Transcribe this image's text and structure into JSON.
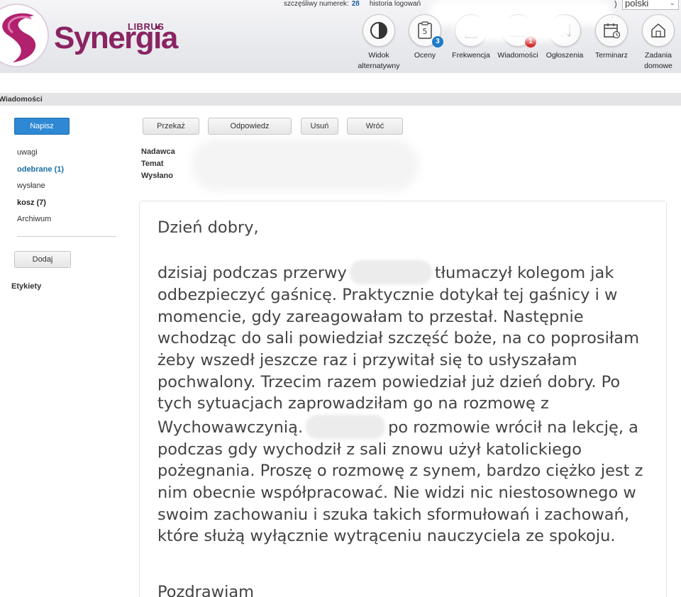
{
  "brand": {
    "product": "Synergia",
    "vendor": "LIBRUS"
  },
  "topbar": {
    "lucky_label": "szczęśliwy numerek:",
    "lucky_number": "28",
    "login_history": "historia logowań",
    "paren": ")",
    "language": "polski"
  },
  "nav": [
    {
      "label": "Widok alternatywny",
      "icon": "half-circle-icon"
    },
    {
      "label": "Oceny",
      "icon": "grades-icon",
      "badge": "3"
    },
    {
      "label": "Frekwencja",
      "icon": "attendance-icon"
    },
    {
      "label": "Wiadomości",
      "icon": "envelope-icon",
      "badge": "1"
    },
    {
      "label": "Ogłoszenia",
      "icon": "megaphone-icon"
    },
    {
      "label": "Terminarz",
      "icon": "calendar-icon"
    },
    {
      "label": "Zadania domowe",
      "icon": "house-icon"
    }
  ],
  "colors": {
    "accent": "#2e88d4",
    "brand": "#8a2462",
    "badge_blue": "#1e7cc8",
    "badge_red": "#d11a1a"
  },
  "section": {
    "title": "Wiadomości"
  },
  "sidebar": {
    "compose": "Napisz",
    "folders": [
      "uwagi",
      "odebrane (1)",
      "wysłane",
      "kosz (7)",
      "Archiwum"
    ],
    "add": "Dodaj",
    "labels_title": "Etykiety"
  },
  "toolbar": {
    "forward": "Przekaż",
    "reply": "Odpowiedz",
    "delete": "Usuń",
    "back": "Wróć"
  },
  "meta": {
    "sender": "Nadawca",
    "subject": "Temat",
    "sent": "Wysłano"
  },
  "message": {
    "greeting": "Dzień dobry,",
    "p1_a": "dzisiaj podczas przerwy",
    "p1_b": "tłumaczył kolegom jak odbezpieczyć gaśnicę. Praktycznie dotykał tej gaśnicy i w momencie, gdy zareagowałam to przestał. Następnie wchodząc do sali powiedział szczęść boże, na co poprosiłam żeby wszedł jeszcze raz i przywitał się to usłyszałam pochwalony. Trzecim razem powiedział już dzień dobry. Po tych sytuacjach zaprowadziłam go na rozmowę z Wychowawczynią.",
    "p1_c": "po rozmowie wrócił na lekcję, a podczas gdy wychodził z sali znowu użył katolickiego pożegnania. Proszę o rozmowę z synem, bardzo ciężko jest z nim obecnie współpracować. Nie widzi nic niestosownego w swoim zachowaniu i szuka takich sformułowań i zachowań, które służą wyłącznie wytrąceniu nauczyciela ze spokoju.",
    "closing": "Pozdrawiam"
  }
}
